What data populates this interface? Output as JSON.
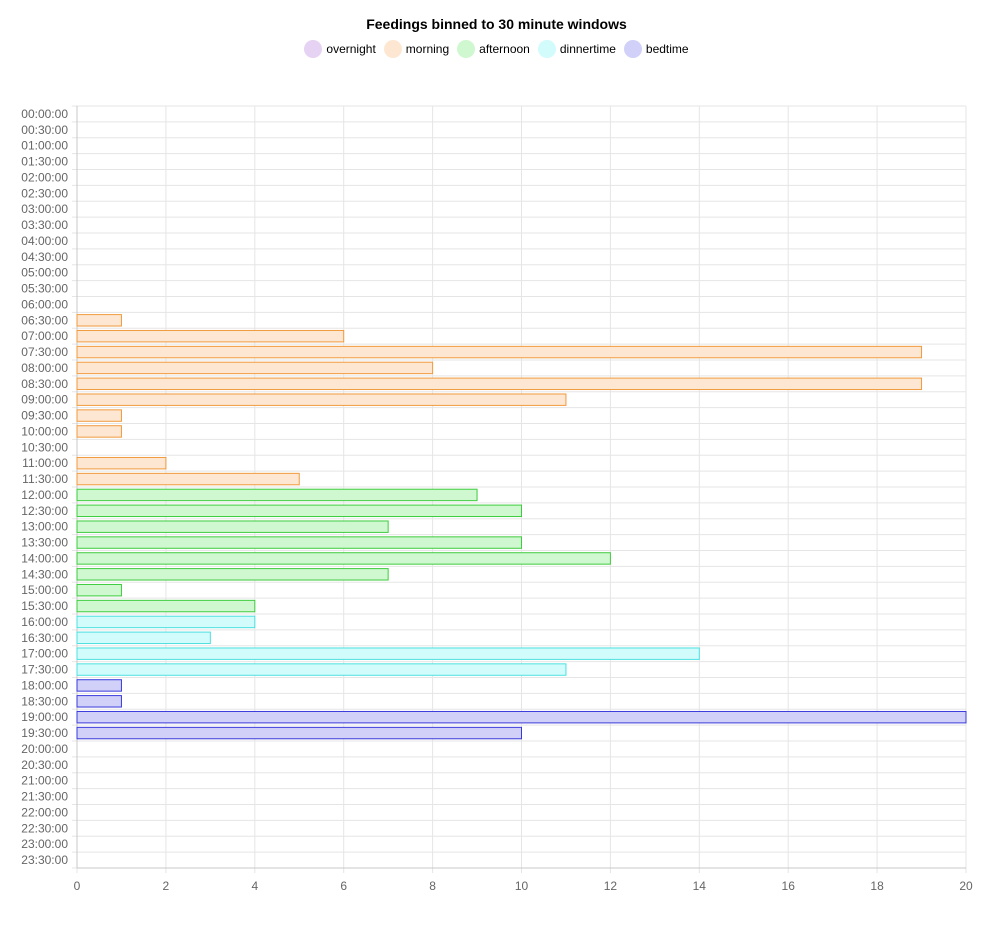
{
  "chart_data": {
    "type": "bar",
    "orientation": "horizontal",
    "title": "Feedings binned to 30 minute windows",
    "xlabel": "",
    "ylabel": "",
    "xlim": [
      0,
      20
    ],
    "x_ticks": [
      0,
      2,
      4,
      6,
      8,
      10,
      12,
      14,
      16,
      18,
      20
    ],
    "grid": true,
    "legend_position": "top-center",
    "legend": [
      {
        "name": "overnight",
        "fill": "#e6d2f2",
        "border": "#b27ad6"
      },
      {
        "name": "morning",
        "fill": "#fde7d2",
        "border": "#f09a3e"
      },
      {
        "name": "afternoon",
        "fill": "#d0f8d0",
        "border": "#3dcc3d"
      },
      {
        "name": "dinnertime",
        "fill": "#d2fbfb",
        "border": "#4de0e0"
      },
      {
        "name": "bedtime",
        "fill": "#d0d0f8",
        "border": "#3a3adb"
      }
    ],
    "categories": [
      "00:00:00",
      "00:30:00",
      "01:00:00",
      "01:30:00",
      "02:00:00",
      "02:30:00",
      "03:00:00",
      "03:30:00",
      "04:00:00",
      "04:30:00",
      "05:00:00",
      "05:30:00",
      "06:00:00",
      "06:30:00",
      "07:00:00",
      "07:30:00",
      "08:00:00",
      "08:30:00",
      "09:00:00",
      "09:30:00",
      "10:00:00",
      "10:30:00",
      "11:00:00",
      "11:30:00",
      "12:00:00",
      "12:30:00",
      "13:00:00",
      "13:30:00",
      "14:00:00",
      "14:30:00",
      "15:00:00",
      "15:30:00",
      "16:00:00",
      "16:30:00",
      "17:00:00",
      "17:30:00",
      "18:00:00",
      "18:30:00",
      "19:00:00",
      "19:30:00",
      "20:00:00",
      "20:30:00",
      "21:00:00",
      "21:30:00",
      "22:00:00",
      "22:30:00",
      "23:00:00",
      "23:30:00"
    ],
    "values": [
      0,
      0,
      0,
      0,
      0,
      0,
      0,
      0,
      0,
      0,
      0,
      0,
      0,
      1,
      6,
      19,
      8,
      19,
      11,
      1,
      1,
      0,
      2,
      5,
      9,
      10,
      7,
      10,
      12,
      7,
      1,
      4,
      4,
      3,
      14,
      11,
      1,
      1,
      20,
      10,
      0,
      0,
      0,
      0,
      0,
      0,
      0,
      0
    ],
    "category_series": [
      "overnight",
      "overnight",
      "overnight",
      "overnight",
      "overnight",
      "overnight",
      "overnight",
      "overnight",
      "overnight",
      "overnight",
      "overnight",
      "overnight",
      "morning",
      "morning",
      "morning",
      "morning",
      "morning",
      "morning",
      "morning",
      "morning",
      "morning",
      "morning",
      "morning",
      "morning",
      "afternoon",
      "afternoon",
      "afternoon",
      "afternoon",
      "afternoon",
      "afternoon",
      "afternoon",
      "afternoon",
      "dinnertime",
      "dinnertime",
      "dinnertime",
      "dinnertime",
      "bedtime",
      "bedtime",
      "bedtime",
      "bedtime",
      "bedtime",
      "bedtime",
      "overnight",
      "overnight",
      "overnight",
      "overnight",
      "overnight",
      "overnight"
    ]
  }
}
